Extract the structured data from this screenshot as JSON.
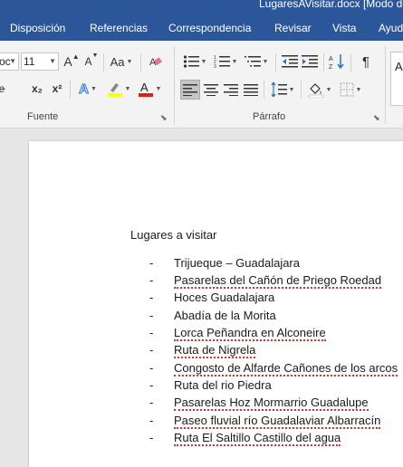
{
  "window": {
    "title": "LugaresAVisitar.docx [Modo de"
  },
  "tabs": [
    {
      "label": "Disposición"
    },
    {
      "label": "Referencias"
    },
    {
      "label": "Correspondencia"
    },
    {
      "label": "Revisar"
    },
    {
      "label": "Vista"
    },
    {
      "label": "Ayuda"
    }
  ],
  "ribbon": {
    "font_name": "oc",
    "font_size": "11",
    "grow_label": "A",
    "shrink_label": "A",
    "case_label": "Aa",
    "subscript_label": "x₂",
    "superscript_label": "x²",
    "effects_label": "A",
    "font_color_label": "A",
    "strike_label": "abc",
    "highlight_color": "#ffff00",
    "font_color": "#e02020",
    "groups": {
      "fuente": "Fuente",
      "parrafo": "Párrafo"
    },
    "style_preview": "A"
  },
  "document": {
    "heading": "Lugares a visitar",
    "bullet": "-",
    "items": [
      "Trijueque – Guadalajara",
      "Pasarelas del Cañón de Priego Roedad",
      "Hoces Guadalajara",
      "Abadía de la Morita",
      "Lorca Peñandra en Alconeire",
      "Ruta de Nigrela",
      "Congosto de Alfarde Cañones de los arcos",
      "Ruta del rio Piedra",
      "Pasarelas Hoz Mormarrio Guadalupe",
      "Paseo fluvial río Guadalaviar Albarracín",
      "Ruta El Saltillo Castillo del agua"
    ]
  }
}
